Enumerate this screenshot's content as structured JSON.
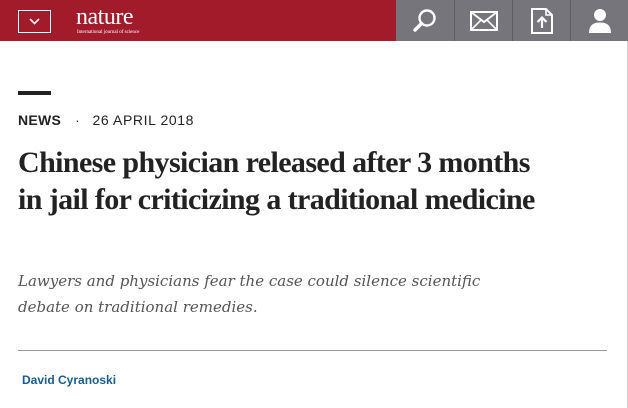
{
  "header": {
    "logo_text": "nature",
    "logo_tagline": "International journal of science",
    "icons": [
      "chevron-down-icon",
      "search-icon",
      "mail-icon",
      "upload-icon",
      "user-icon"
    ]
  },
  "article": {
    "type": "NEWS",
    "separator": "·",
    "date": "26 APRIL 2018",
    "title": "Chinese physician released after 3 months in jail for criticizing a traditional medicine",
    "standfirst": "Lawyers and physicians fear the case could silence scientific debate on traditional remedies.",
    "author": "David Cyranoski"
  },
  "colors": {
    "brand": "#a11b2b",
    "icon_bar": "#75757b",
    "author_link": "#1a5c8a"
  }
}
